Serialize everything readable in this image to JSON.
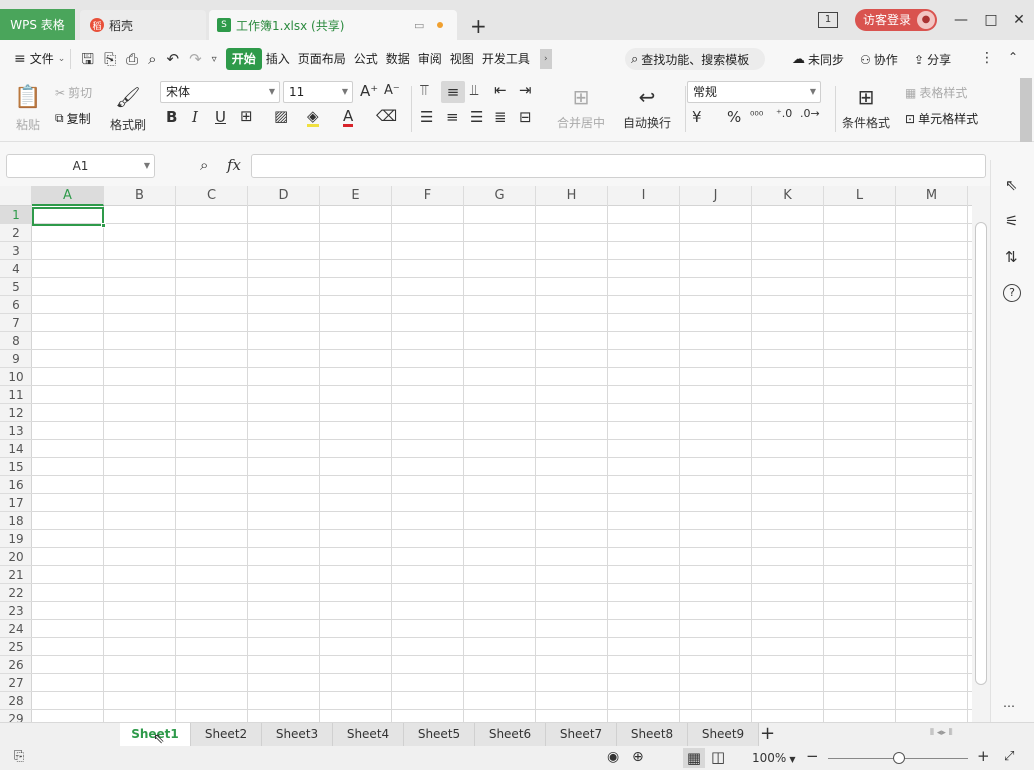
{
  "tabs": {
    "wps": "WPS 表格",
    "daoke": "稻壳",
    "doc": "工作簿1.xlsx (共享)"
  },
  "titlebar": {
    "window_count": "1",
    "login": "访客登录"
  },
  "menu": {
    "file": "文件",
    "items": [
      "开始",
      "插入",
      "页面布局",
      "公式",
      "数据",
      "审阅",
      "视图",
      "开发工具"
    ],
    "search": "查找功能、搜索模板",
    "sync": "未同步",
    "collab": "协作",
    "share": "分享"
  },
  "ribbon": {
    "paste": "粘贴",
    "cut": "剪切",
    "copy": "复制",
    "format_painter": "格式刷",
    "font": "宋体",
    "font_size": "11",
    "merge": "合并居中",
    "wrap": "自动换行",
    "number_format": "常规",
    "currency": "¥",
    "percent": "%",
    "cond_format": "条件格式",
    "table_style": "表格样式",
    "cell_style": "单元格样式"
  },
  "formula": {
    "cell_ref": "A1",
    "fx": "fx"
  },
  "grid": {
    "columns": [
      "A",
      "B",
      "C",
      "D",
      "E",
      "F",
      "G",
      "H",
      "I",
      "J",
      "K",
      "L",
      "M"
    ],
    "rows": [
      "1",
      "2",
      "3",
      "4",
      "5",
      "6",
      "7",
      "8",
      "9",
      "10",
      "11",
      "12",
      "13",
      "14",
      "15",
      "16",
      "17",
      "18",
      "19",
      "20",
      "21",
      "22",
      "23",
      "24",
      "25",
      "26",
      "27",
      "28",
      "29"
    ],
    "selected_column": "A",
    "selected_row": "1"
  },
  "sheets": [
    "Sheet1",
    "Sheet2",
    "Sheet3",
    "Sheet4",
    "Sheet5",
    "Sheet6",
    "Sheet7",
    "Sheet8",
    "Sheet9"
  ],
  "active_sheet": "Sheet1",
  "status": {
    "zoom": "100%"
  },
  "colors": {
    "accent": "#2e9a4a",
    "wps_tab": "#4aa55b",
    "login": "#d9534f"
  }
}
